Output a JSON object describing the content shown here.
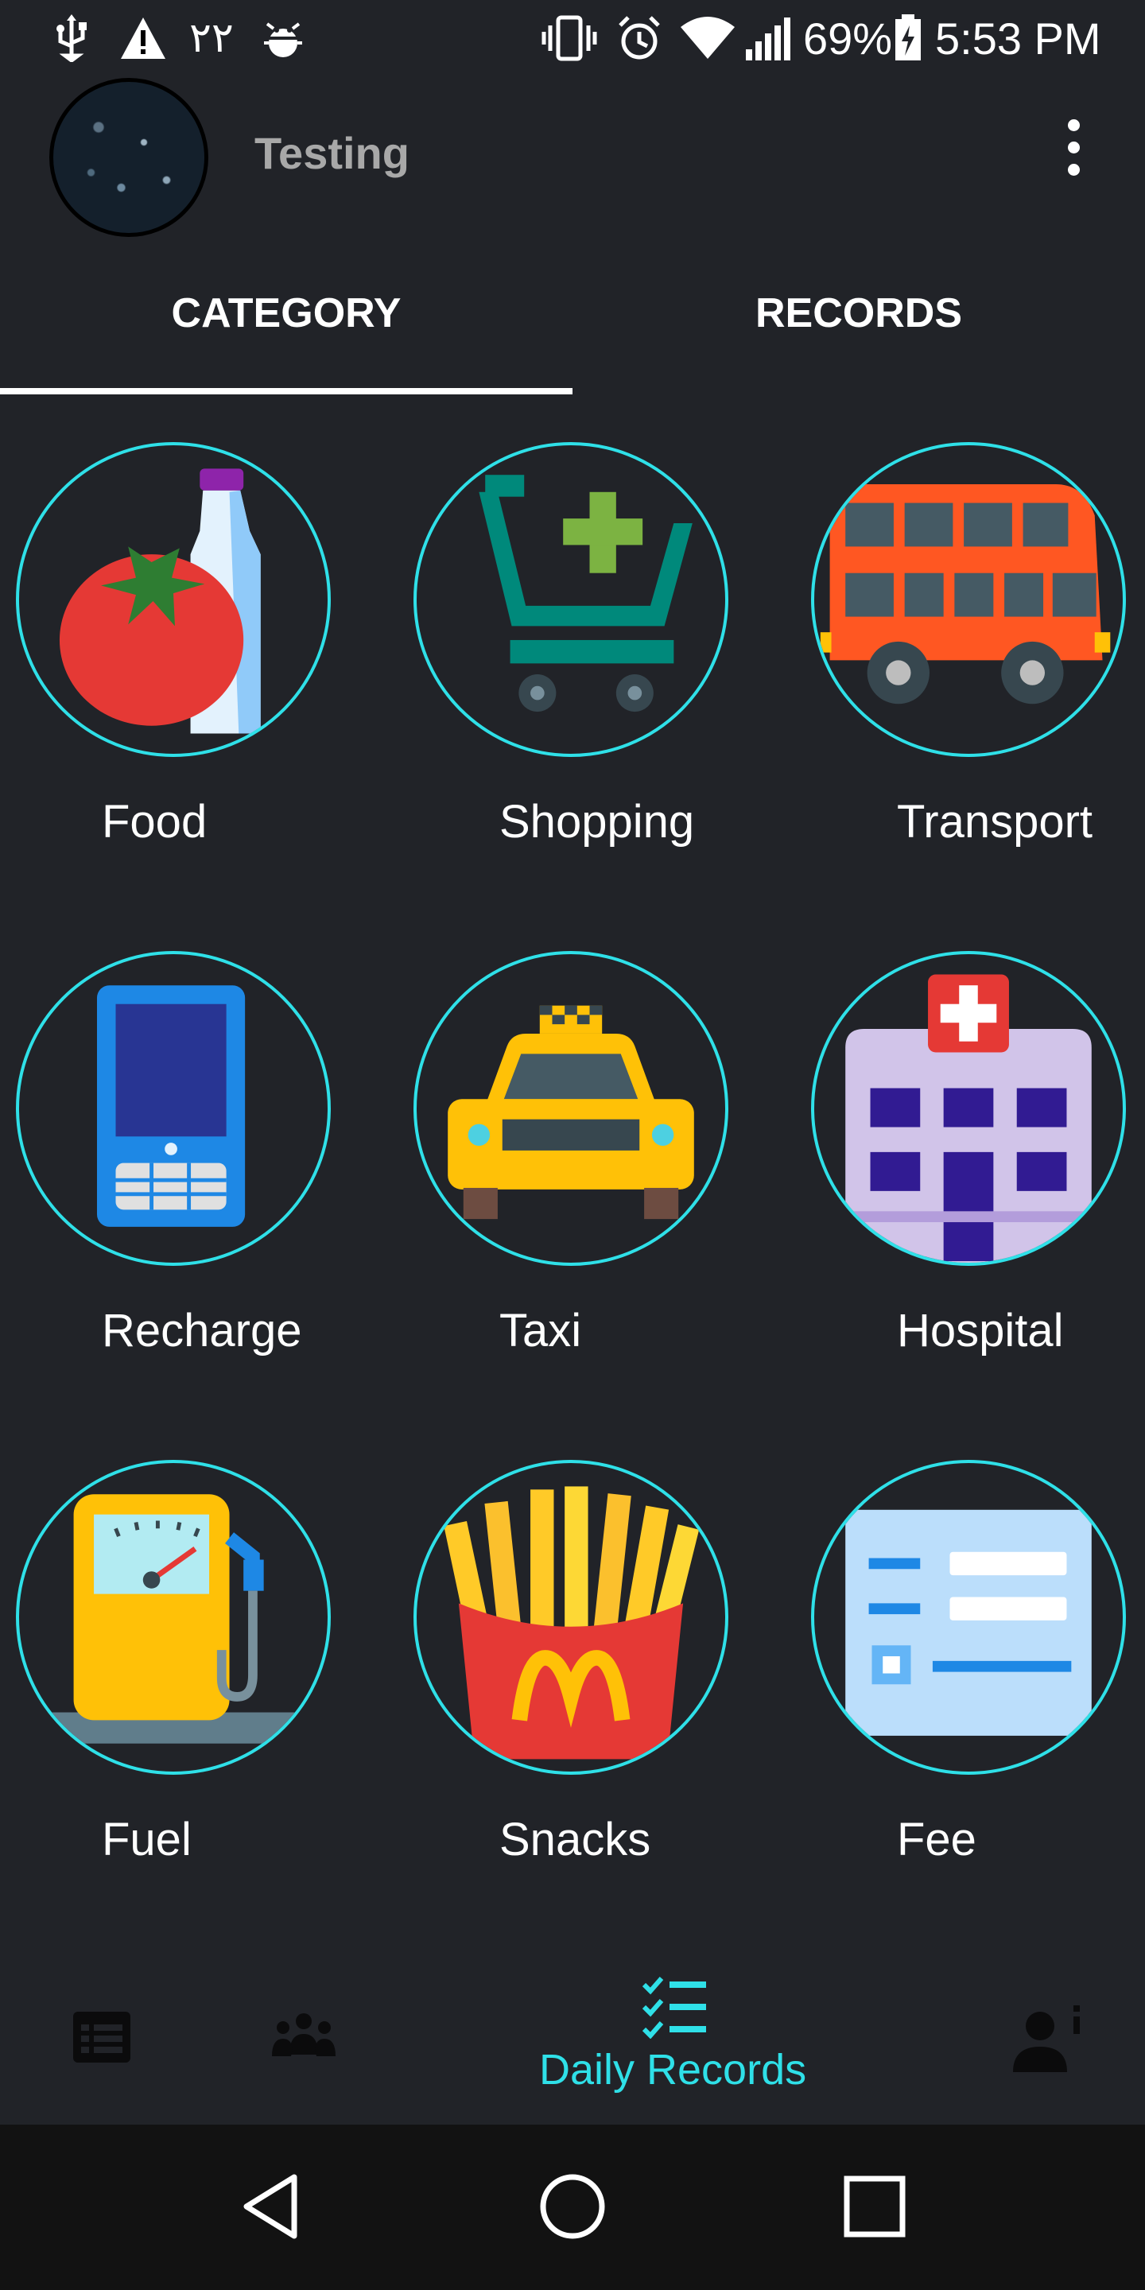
{
  "status_bar": {
    "notification_text": "٢٢",
    "battery_percent": "69%",
    "time": "5:53 PM",
    "icons": [
      "usb-icon",
      "warning-icon",
      "android-debug-icon",
      "vibrate-icon",
      "alarm-icon",
      "wifi-icon",
      "signal-icon",
      "battery-charging-icon"
    ]
  },
  "app_bar": {
    "title": "Testing",
    "avatar_icon": "profile-avatar",
    "menu_icon": "more-vert-icon"
  },
  "tabs": [
    {
      "label": "CATEGORY",
      "selected": true
    },
    {
      "label": "RECORDS",
      "selected": false
    }
  ],
  "categories": [
    {
      "label": "Food",
      "icon": "food-icon"
    },
    {
      "label": "Shopping",
      "icon": "shopping-cart-icon"
    },
    {
      "label": "Transport",
      "icon": "bus-icon"
    },
    {
      "label": "Recharge",
      "icon": "mobile-phone-icon"
    },
    {
      "label": "Taxi",
      "icon": "taxi-icon"
    },
    {
      "label": "Hospital",
      "icon": "hospital-icon"
    },
    {
      "label": "Fuel",
      "icon": "fuel-pump-icon"
    },
    {
      "label": "Snacks",
      "icon": "fries-icon"
    },
    {
      "label": "Fee",
      "icon": "form-icon"
    }
  ],
  "bottom_nav": {
    "active_label": "Daily Records",
    "items": [
      "list-icon",
      "group-icon",
      "daily-records-icon",
      "user-info-icon"
    ]
  },
  "colors": {
    "background": "#212328",
    "accent": "#2fe0e8",
    "navbar": "#121212"
  }
}
